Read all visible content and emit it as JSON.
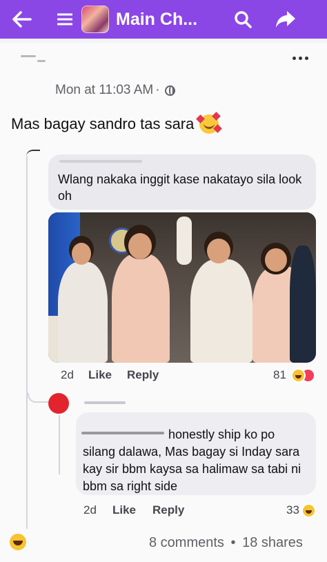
{
  "header": {
    "back_icon": "arrow-left-icon",
    "menu_icon": "hamburger-menu-icon",
    "group_title": "Main Ch...",
    "search_icon": "search-icon",
    "share_icon": "share-arrow-icon",
    "background_color": "#8a47e6"
  },
  "post": {
    "timestamp": "Mon at 11:03 AM",
    "separator": "·",
    "privacy_icon": "globe-icon",
    "more_icon": "more-dots-icon",
    "text": "Mas bagay sandro tas sara",
    "emoji": "smiling-face-with-hearts-emoji"
  },
  "comment1": {
    "text": "Wlang nakaka inggit kase nakatayo sila look oh",
    "time": "2d",
    "like_label": "Like",
    "reply_label": "Reply",
    "reaction_count": "81",
    "reactions": [
      "haha",
      "wow"
    ]
  },
  "comment2": {
    "text": "honestly ship ko po silang dalawa, Mas bagay si Inday sara kay sir bbm kaysa sa halimaw sa tabi ni bbm sa right side",
    "time": "2d",
    "like_label": "Like",
    "reply_label": "Reply",
    "reaction_count": "33",
    "reactions": [
      "haha"
    ]
  },
  "footer": {
    "reaction": "haha",
    "comments": "8 comments",
    "separator": "•",
    "shares": "18 shares"
  }
}
